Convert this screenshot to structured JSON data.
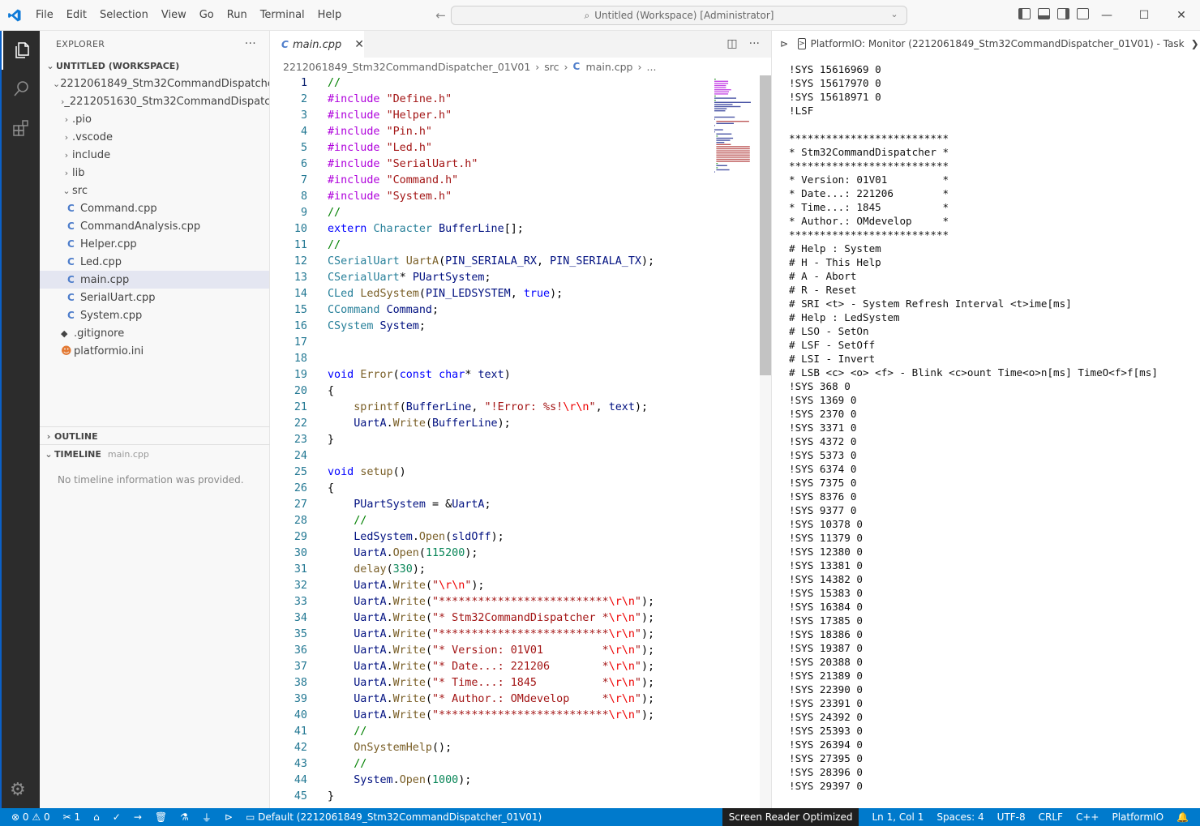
{
  "titlebar": {
    "menu": [
      "File",
      "Edit",
      "Selection",
      "View",
      "Go",
      "Run",
      "Terminal",
      "Help"
    ],
    "command_center": "Untitled (Workspace) [Administrator]"
  },
  "sidebar": {
    "title": "EXPLORER",
    "workspace": "UNTITLED (WORKSPACE)",
    "project": "2212061849_Stm32CommandDispatcher_...",
    "items": [
      {
        "label": "_2212051630_Stm32CommandDispatch...",
        "kind": "folder"
      },
      {
        "label": ".pio",
        "kind": "folder"
      },
      {
        "label": ".vscode",
        "kind": "folder"
      },
      {
        "label": "include",
        "kind": "folder"
      },
      {
        "label": "lib",
        "kind": "folder"
      },
      {
        "label": "src",
        "kind": "folder-open"
      }
    ],
    "src_files": [
      "Command.cpp",
      "CommandAnalysis.cpp",
      "Helper.cpp",
      "Led.cpp",
      "main.cpp",
      "SerialUart.cpp",
      "System.cpp"
    ],
    "root_files": [
      ".gitignore",
      "platformio.ini"
    ],
    "outline": "OUTLINE",
    "timeline": "TIMELINE",
    "timeline_file": "main.cpp",
    "timeline_empty": "No timeline information was provided."
  },
  "editor": {
    "tab": "main.cpp",
    "breadcrumb": [
      "2212061849_Stm32CommandDispatcher_01V01",
      "src",
      "main.cpp",
      "..."
    ],
    "lines": [
      "//",
      "#include \"Define.h\"",
      "#include \"Helper.h\"",
      "#include \"Pin.h\"",
      "#include \"Led.h\"",
      "#include \"SerialUart.h\"",
      "#include \"Command.h\"",
      "#include \"System.h\"",
      "//",
      "extern Character BufferLine[];",
      "//",
      "CSerialUart UartA(PIN_SERIALA_RX, PIN_SERIALA_TX);",
      "CSerialUart* PUartSystem;",
      "CLed LedSystem(PIN_LEDSYSTEM, true);",
      "CCommand Command;",
      "CSystem System;",
      "",
      "",
      "void Error(const char* text)",
      "{",
      "    sprintf(BufferLine, \"!Error: %s!\\r\\n\", text);",
      "    UartA.Write(BufferLine);",
      "}",
      "",
      "void setup()",
      "{",
      "    PUartSystem = &UartA;",
      "    //",
      "    LedSystem.Open(sldOff);",
      "    UartA.Open(115200);",
      "    delay(330);",
      "    UartA.Write(\"\\r\\n\");",
      "    UartA.Write(\"**************************\\r\\n\");",
      "    UartA.Write(\"* Stm32CommandDispatcher *\\r\\n\");",
      "    UartA.Write(\"**************************\\r\\n\");",
      "    UartA.Write(\"* Version: 01V01         *\\r\\n\");",
      "    UartA.Write(\"* Date...: 221206        *\\r\\n\");",
      "    UartA.Write(\"* Time...: 1845          *\\r\\n\");",
      "    UartA.Write(\"* Author.: OMdevelop     *\\r\\n\");",
      "    UartA.Write(\"**************************\\r\\n\");",
      "    //",
      "    OnSystemHelp();",
      "    //",
      "    System.Open(1000);",
      "}"
    ]
  },
  "panel": {
    "title": "PlatformIO: Monitor (2212061849_Stm32CommandDispatcher_01V01) - Task",
    "lines": [
      "!SYS 15616969 0",
      "!SYS 15617970 0",
      "!SYS 15618971 0",
      "!LSF",
      "",
      "**************************",
      "* Stm32CommandDispatcher *",
      "**************************",
      "* Version: 01V01         *",
      "* Date...: 221206        *",
      "* Time...: 1845          *",
      "* Author.: OMdevelop     *",
      "**************************",
      "# Help : System",
      "# H - This Help",
      "# A - Abort",
      "# R - Reset",
      "# SRI <t> - System Refresh Interval <t>ime[ms]",
      "# Help : LedSystem",
      "# LSO - SetOn",
      "# LSF - SetOff",
      "# LSI - Invert",
      "# LSB <c> <o> <f> - Blink <c>ount Time<o>n[ms] TimeO<f>f[ms]",
      "!SYS 368 0",
      "!SYS 1369 0",
      "!SYS 2370 0",
      "!SYS 3371 0",
      "!SYS 4372 0",
      "!SYS 5373 0",
      "!SYS 6374 0",
      "!SYS 7375 0",
      "!SYS 8376 0",
      "!SYS 9377 0",
      "!SYS 10378 0",
      "!SYS 11379 0",
      "!SYS 12380 0",
      "!SYS 13381 0",
      "!SYS 14382 0",
      "!SYS 15383 0",
      "!SYS 16384 0",
      "!SYS 17385 0",
      "!SYS 18386 0",
      "!SYS 19387 0",
      "!SYS 20388 0",
      "!SYS 21389 0",
      "!SYS 22390 0",
      "!SYS 23391 0",
      "!SYS 24392 0",
      "!SYS 25393 0",
      "!SYS 26394 0",
      "!SYS 27395 0",
      "!SYS 28396 0",
      "!SYS 29397 0"
    ]
  },
  "statusbar": {
    "errors": "0",
    "warnings": "0",
    "ports": "1",
    "env": "Default (2212061849_Stm32CommandDispatcher_01V01)",
    "screen_reader": "Screen Reader Optimized",
    "position": "Ln 1, Col 1",
    "spaces": "Spaces: 4",
    "encoding": "UTF-8",
    "eol": "CRLF",
    "language": "C++",
    "platformio": "PlatformIO"
  },
  "colors": {
    "statusbar": "#007acc",
    "activitybar": "#2c2c2c",
    "selection": "#e4e6f1"
  }
}
